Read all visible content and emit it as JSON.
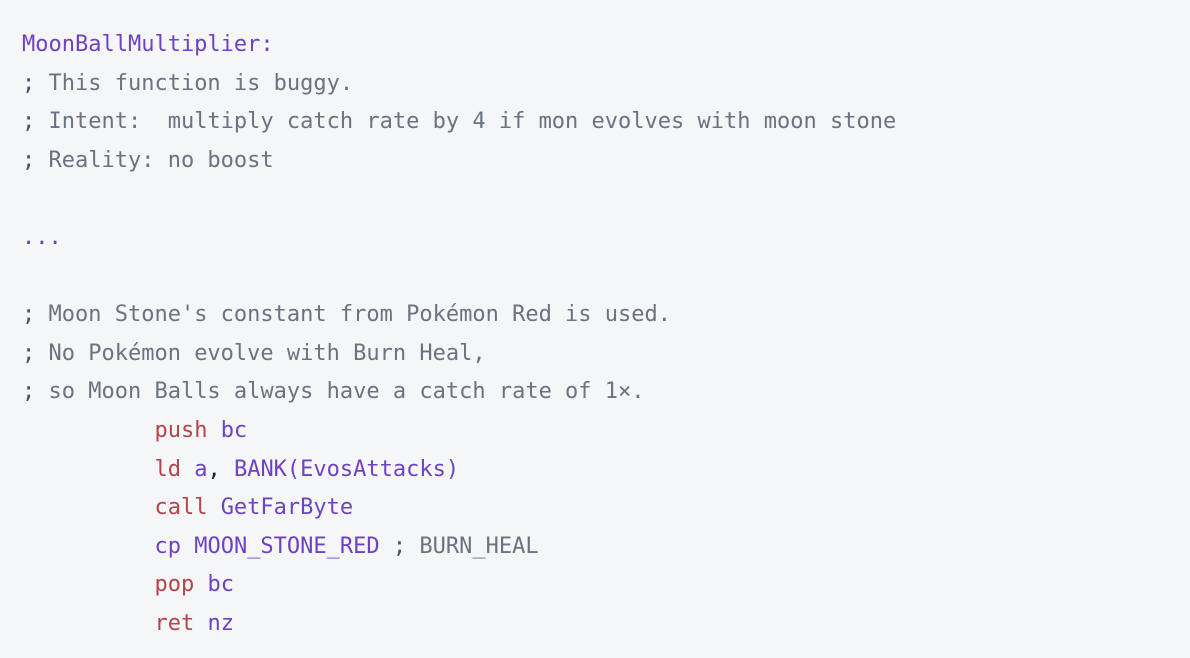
{
  "editor": {
    "background_color": "#f5f6f8",
    "language": "assembly-rgbasm",
    "font_size_px": 22,
    "colors": {
      "label": "#6f42c1",
      "comment": "#6b7280",
      "comment_marker": "#4a5260",
      "keyword": "#b5444a",
      "operand": "#6f42c1",
      "punctuation": "#1b1f24"
    }
  },
  "code": {
    "label_line": "MoonBallMultiplier:",
    "comment_marker": ";",
    "comments_top": [
      " This function is buggy.",
      " Intent:  multiply catch rate by 4 if mon evolves with moon stone",
      " Reality: no boost"
    ],
    "ellipsis": "...",
    "comments_mid": [
      " Moon Stone's constant from Pokémon Red is used.",
      " No Pokémon evolve with Burn Heal,",
      " so Moon Balls always have a catch rate of 1×."
    ],
    "indent": "          ",
    "instructions": [
      {
        "keyword": "push",
        "keyword_style": "keyword",
        "gap": " ",
        "operand": "bc",
        "punct": "",
        "operand2": "",
        "trailing_comment_marker": "",
        "trailing_comment": ""
      },
      {
        "keyword": "ld",
        "keyword_style": "keyword",
        "gap": " ",
        "operand": "a",
        "punct": ",",
        "operand2": " BANK(EvosAttacks)",
        "trailing_comment_marker": "",
        "trailing_comment": ""
      },
      {
        "keyword": "call",
        "keyword_style": "keyword",
        "gap": " ",
        "operand": "GetFarByte",
        "punct": "",
        "operand2": "",
        "trailing_comment_marker": "",
        "trailing_comment": ""
      },
      {
        "keyword": "cp",
        "keyword_style": "operand",
        "gap": " ",
        "operand": "MOON_STONE_RED",
        "punct": "",
        "operand2": "",
        "trailing_comment_marker": " ;",
        "trailing_comment": " BURN_HEAL"
      },
      {
        "keyword": "pop",
        "keyword_style": "keyword",
        "gap": " ",
        "operand": "bc",
        "punct": "",
        "operand2": "",
        "trailing_comment_marker": "",
        "trailing_comment": ""
      },
      {
        "keyword": "ret",
        "keyword_style": "keyword",
        "gap": " ",
        "operand": "nz",
        "punct": "",
        "operand2": "",
        "trailing_comment_marker": "",
        "trailing_comment": ""
      }
    ]
  }
}
